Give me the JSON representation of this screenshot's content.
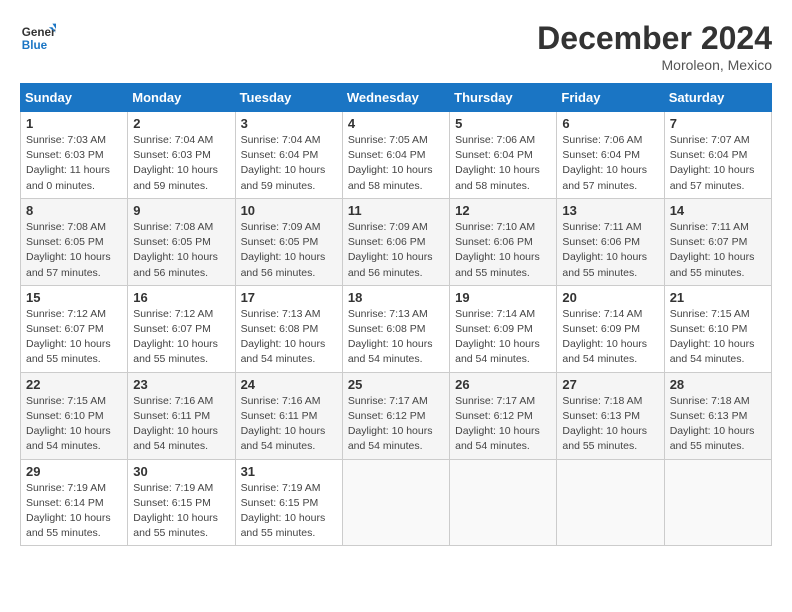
{
  "header": {
    "logo_line1": "General",
    "logo_line2": "Blue",
    "month": "December 2024",
    "location": "Moroleon, Mexico"
  },
  "weekdays": [
    "Sunday",
    "Monday",
    "Tuesday",
    "Wednesday",
    "Thursday",
    "Friday",
    "Saturday"
  ],
  "weeks": [
    [
      {
        "day": "1",
        "info": "Sunrise: 7:03 AM\nSunset: 6:03 PM\nDaylight: 11 hours\nand 0 minutes."
      },
      {
        "day": "2",
        "info": "Sunrise: 7:04 AM\nSunset: 6:03 PM\nDaylight: 10 hours\nand 59 minutes."
      },
      {
        "day": "3",
        "info": "Sunrise: 7:04 AM\nSunset: 6:04 PM\nDaylight: 10 hours\nand 59 minutes."
      },
      {
        "day": "4",
        "info": "Sunrise: 7:05 AM\nSunset: 6:04 PM\nDaylight: 10 hours\nand 58 minutes."
      },
      {
        "day": "5",
        "info": "Sunrise: 7:06 AM\nSunset: 6:04 PM\nDaylight: 10 hours\nand 58 minutes."
      },
      {
        "day": "6",
        "info": "Sunrise: 7:06 AM\nSunset: 6:04 PM\nDaylight: 10 hours\nand 57 minutes."
      },
      {
        "day": "7",
        "info": "Sunrise: 7:07 AM\nSunset: 6:04 PM\nDaylight: 10 hours\nand 57 minutes."
      }
    ],
    [
      {
        "day": "8",
        "info": "Sunrise: 7:08 AM\nSunset: 6:05 PM\nDaylight: 10 hours\nand 57 minutes."
      },
      {
        "day": "9",
        "info": "Sunrise: 7:08 AM\nSunset: 6:05 PM\nDaylight: 10 hours\nand 56 minutes."
      },
      {
        "day": "10",
        "info": "Sunrise: 7:09 AM\nSunset: 6:05 PM\nDaylight: 10 hours\nand 56 minutes."
      },
      {
        "day": "11",
        "info": "Sunrise: 7:09 AM\nSunset: 6:06 PM\nDaylight: 10 hours\nand 56 minutes."
      },
      {
        "day": "12",
        "info": "Sunrise: 7:10 AM\nSunset: 6:06 PM\nDaylight: 10 hours\nand 55 minutes."
      },
      {
        "day": "13",
        "info": "Sunrise: 7:11 AM\nSunset: 6:06 PM\nDaylight: 10 hours\nand 55 minutes."
      },
      {
        "day": "14",
        "info": "Sunrise: 7:11 AM\nSunset: 6:07 PM\nDaylight: 10 hours\nand 55 minutes."
      }
    ],
    [
      {
        "day": "15",
        "info": "Sunrise: 7:12 AM\nSunset: 6:07 PM\nDaylight: 10 hours\nand 55 minutes."
      },
      {
        "day": "16",
        "info": "Sunrise: 7:12 AM\nSunset: 6:07 PM\nDaylight: 10 hours\nand 55 minutes."
      },
      {
        "day": "17",
        "info": "Sunrise: 7:13 AM\nSunset: 6:08 PM\nDaylight: 10 hours\nand 54 minutes."
      },
      {
        "day": "18",
        "info": "Sunrise: 7:13 AM\nSunset: 6:08 PM\nDaylight: 10 hours\nand 54 minutes."
      },
      {
        "day": "19",
        "info": "Sunrise: 7:14 AM\nSunset: 6:09 PM\nDaylight: 10 hours\nand 54 minutes."
      },
      {
        "day": "20",
        "info": "Sunrise: 7:14 AM\nSunset: 6:09 PM\nDaylight: 10 hours\nand 54 minutes."
      },
      {
        "day": "21",
        "info": "Sunrise: 7:15 AM\nSunset: 6:10 PM\nDaylight: 10 hours\nand 54 minutes."
      }
    ],
    [
      {
        "day": "22",
        "info": "Sunrise: 7:15 AM\nSunset: 6:10 PM\nDaylight: 10 hours\nand 54 minutes."
      },
      {
        "day": "23",
        "info": "Sunrise: 7:16 AM\nSunset: 6:11 PM\nDaylight: 10 hours\nand 54 minutes."
      },
      {
        "day": "24",
        "info": "Sunrise: 7:16 AM\nSunset: 6:11 PM\nDaylight: 10 hours\nand 54 minutes."
      },
      {
        "day": "25",
        "info": "Sunrise: 7:17 AM\nSunset: 6:12 PM\nDaylight: 10 hours\nand 54 minutes."
      },
      {
        "day": "26",
        "info": "Sunrise: 7:17 AM\nSunset: 6:12 PM\nDaylight: 10 hours\nand 54 minutes."
      },
      {
        "day": "27",
        "info": "Sunrise: 7:18 AM\nSunset: 6:13 PM\nDaylight: 10 hours\nand 55 minutes."
      },
      {
        "day": "28",
        "info": "Sunrise: 7:18 AM\nSunset: 6:13 PM\nDaylight: 10 hours\nand 55 minutes."
      }
    ],
    [
      {
        "day": "29",
        "info": "Sunrise: 7:19 AM\nSunset: 6:14 PM\nDaylight: 10 hours\nand 55 minutes."
      },
      {
        "day": "30",
        "info": "Sunrise: 7:19 AM\nSunset: 6:15 PM\nDaylight: 10 hours\nand 55 minutes."
      },
      {
        "day": "31",
        "info": "Sunrise: 7:19 AM\nSunset: 6:15 PM\nDaylight: 10 hours\nand 55 minutes."
      },
      {
        "day": "",
        "info": ""
      },
      {
        "day": "",
        "info": ""
      },
      {
        "day": "",
        "info": ""
      },
      {
        "day": "",
        "info": ""
      }
    ]
  ]
}
